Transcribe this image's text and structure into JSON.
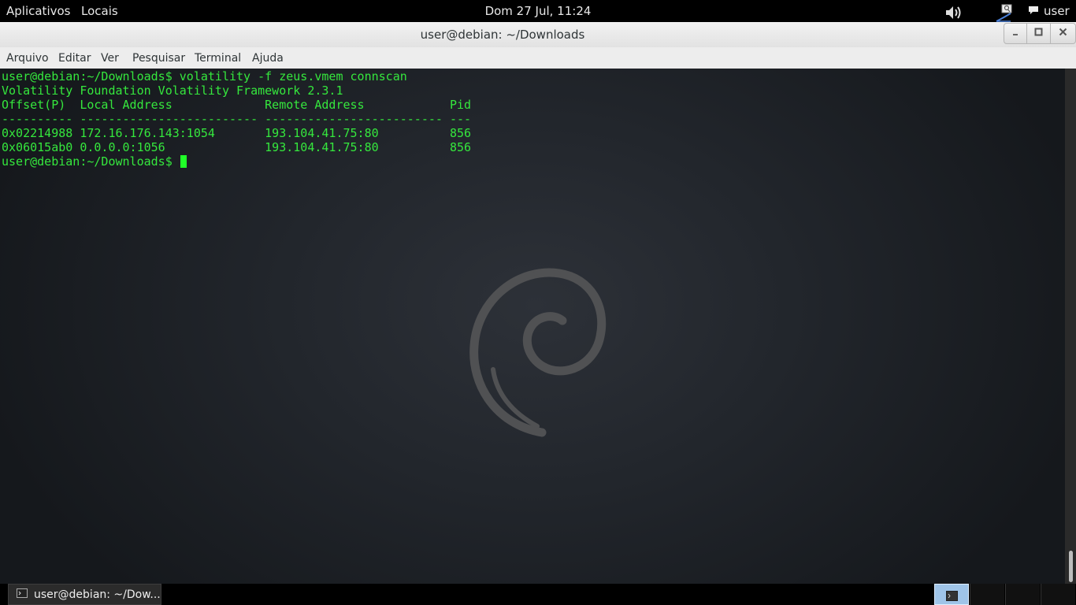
{
  "top_panel": {
    "applications": "Aplicativos",
    "places": "Locais",
    "clock": "Dom 27 Jul, 11:24",
    "user": "user",
    "icons": [
      "volume-icon",
      "network-icon",
      "chat-icon"
    ]
  },
  "window": {
    "title": "user@debian: ~/Downloads",
    "buttons": [
      "minimize-icon",
      "maximize-icon",
      "close-icon"
    ],
    "menu": [
      "Arquivo",
      "Editar",
      "Ver",
      "Pesquisar",
      "Terminal",
      "Ajuda"
    ]
  },
  "terminal": {
    "lines": [
      "user@debian:~/Downloads$ volatility -f zeus.vmem connscan",
      "Volatility Foundation Volatility Framework 2.3.1",
      "Offset(P)  Local Address             Remote Address            Pid",
      "---------- ------------------------- ------------------------- ---",
      "0x02214988 172.16.176.143:1054       193.104.41.75:80          856",
      "0x06015ab0 0.0.0.0:1056              193.104.41.75:80          856"
    ],
    "prompt": "user@debian:~/Downloads$ ",
    "colors": {
      "text": "#35e73d",
      "cursor": "#20ff28"
    }
  },
  "taskbar": {
    "task_label": "user@debian: ~/Dow...",
    "task_icon": "terminal-icon",
    "workspaces": 4,
    "active_workspace": 1
  }
}
